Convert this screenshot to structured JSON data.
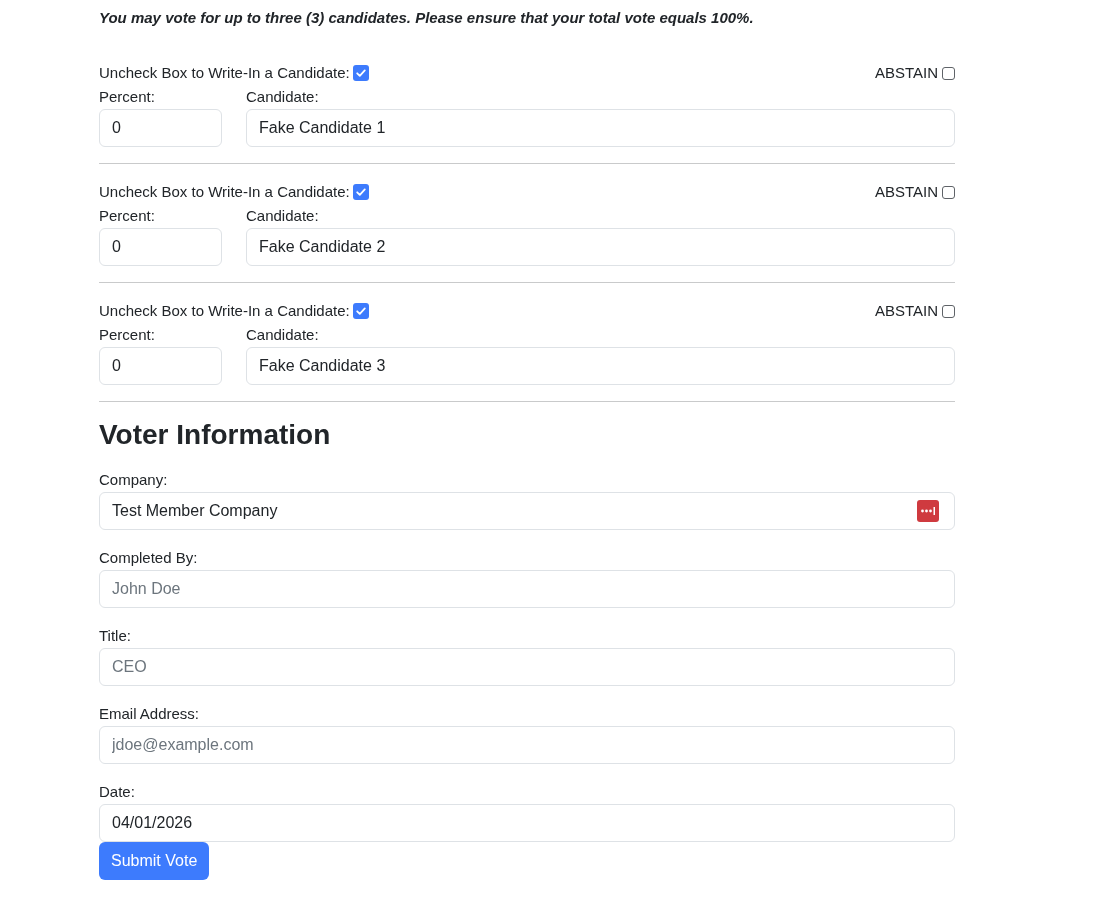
{
  "instruction": "You may vote for up to three (3) candidates. Please ensure that your total vote equals 100%.",
  "candidates": [
    {
      "write_in_label": "Uncheck Box to Write-In a Candidate:",
      "write_in_checked": true,
      "abstain_label": "ABSTAIN",
      "abstain_checked": false,
      "percent_label": "Percent:",
      "percent_value": "0",
      "candidate_label": "Candidate:",
      "candidate_value": "Fake Candidate 1"
    },
    {
      "write_in_label": "Uncheck Box to Write-In a Candidate:",
      "write_in_checked": true,
      "abstain_label": "ABSTAIN",
      "abstain_checked": false,
      "percent_label": "Percent:",
      "percent_value": "0",
      "candidate_label": "Candidate:",
      "candidate_value": "Fake Candidate 2"
    },
    {
      "write_in_label": "Uncheck Box to Write-In a Candidate:",
      "write_in_checked": true,
      "abstain_label": "ABSTAIN",
      "abstain_checked": false,
      "percent_label": "Percent:",
      "percent_value": "0",
      "candidate_label": "Candidate:",
      "candidate_value": "Fake Candidate 3"
    }
  ],
  "voter_information": {
    "heading": "Voter Information",
    "fields": [
      {
        "label": "Company:",
        "value": "Test Member Company",
        "autofill_icon": true
      },
      {
        "label": "Completed By:",
        "placeholder": "John Doe"
      },
      {
        "label": "Title:",
        "placeholder": "CEO"
      },
      {
        "label": "Email Address:",
        "placeholder": "jdoe@example.com"
      },
      {
        "label": "Date:",
        "value": "04/01/2026"
      }
    ]
  },
  "submit_button": "Submit Vote"
}
